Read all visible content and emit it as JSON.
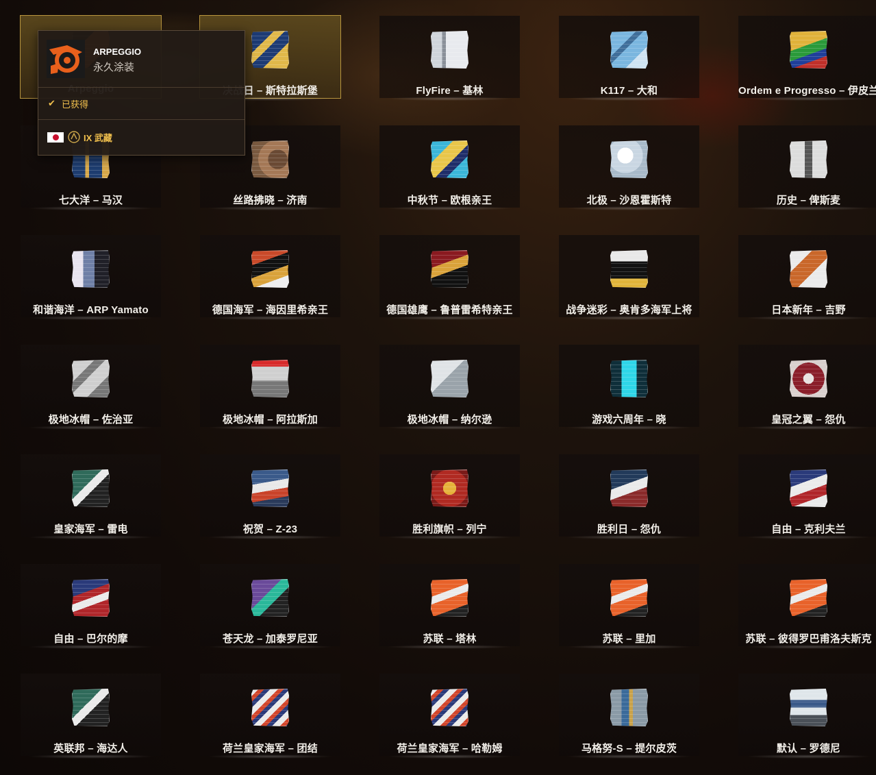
{
  "colors": {
    "accent_gold": "#f2c14e",
    "selected_border": "#b8953e"
  },
  "tooltip": {
    "camo_name": "ARPEGGIO",
    "camo_type": "永久涂装",
    "status": "已获得",
    "ship": "IX 武藏",
    "flag_icon": "japan-flag-icon",
    "tier_icon": "tier-laurel-icon"
  },
  "camouflages": [
    {
      "label": "Arpeggio",
      "bg": "linear-gradient(135deg,#111 0 30%,#e8601c 30% 70%,#111 70%)",
      "selected": true
    },
    {
      "label": "决战日 – 斯特拉斯堡",
      "bg": "linear-gradient(135deg,#1d3b74 0 30%,#e0b84a 30% 45%,#1d3b74 45% 65%,#e0b84a 65%)",
      "selected": true
    },
    {
      "label": "FlyFire – 基林",
      "bg": "linear-gradient(90deg,#cfd4da 0 30%,#8a9099 30% 40%,#e8eaee 40%)",
      "selected": false
    },
    {
      "label": "K117 – 大和",
      "bg": "linear-gradient(135deg,#7ab6df 0 35%,#3f6e9a 35% 45%,#7ab6df 45% 70%,#cfe3f2 70%)",
      "selected": false
    },
    {
      "label": "Ordem e Progresso – 伊皮兰加",
      "bg": "linear-gradient(160deg,#e0b23a 0 40%,#2a9a3a 40% 60%,#1f3f9a 60% 75%,#c0302a 75%)",
      "selected": false
    },
    {
      "label": "七大洋 – 马汉",
      "bg": "linear-gradient(90deg,#1e3d70 0 35%,#d7a84a 35% 45%,#1e3d70 45% 80%,#d7a84a 80%)",
      "selected": false
    },
    {
      "label": "丝路拂晓 – 济南",
      "bg": "radial-gradient(circle at 70% 50%,#6a4a34 0 30%,#a47856 30% 60%,#7a5a40 60%)",
      "selected": false
    },
    {
      "label": "中秋节 – 欧根亲王",
      "bg": "linear-gradient(135deg,#3bb6d9 0 30%,#e8c64a 30% 55%,#1f2e6a 55% 70%,#3bb6d9 70%)",
      "selected": false
    },
    {
      "label": "北极 – 沙恩霍斯特",
      "bg": "radial-gradient(circle at 40% 40%,#ffffff 0 25%,#c9d6e2 25% 55%,#a8bac9 55%)",
      "selected": false
    },
    {
      "label": "历史 – 俾斯麦",
      "bg": "linear-gradient(90deg,#dcdcdc 0 40%,#555 40% 60%,#dcdcdc 60%)",
      "selected": false
    },
    {
      "label": "和谐海洋 – ARP Yamato",
      "bg": "linear-gradient(90deg,#e8e4ef 0 30%,#6e7fa6 30% 60%,#202028 60%)",
      "selected": false
    },
    {
      "label": "德国海军 – 海因里希亲王",
      "bg": "linear-gradient(160deg,#c94a2a 0 30%,#111 30% 55%,#d9a23a 55% 75%,#eee 75%)",
      "selected": false
    },
    {
      "label": "德国雄鹰 – 鲁普雷希特亲王",
      "bg": "linear-gradient(160deg,#8a1a20 0 35%,#d9a23a 35% 55%,#111 55%)",
      "selected": false
    },
    {
      "label": "战争迷彩 – 奥肯多海军上将",
      "bg": "linear-gradient(180deg,#e8e8e8 0 30%,#111 30% 75%,#e0b43a 75%)",
      "selected": false
    },
    {
      "label": "日本新年 – 吉野",
      "bg": "linear-gradient(135deg,#eaeaea 0 30%,#c9672a 30% 60%,#eaeaea 60%)",
      "selected": false
    },
    {
      "label": "极地冰帽 – 佐治亚",
      "bg": "linear-gradient(135deg,#cfcfcf 0 30%,#777 30% 45%,#cfcfcf 45% 70%,#777 70%)",
      "selected": false
    },
    {
      "label": "极地冰帽 – 阿拉斯加",
      "bg": "linear-gradient(180deg,#d82b2b 0 18%,#cfcfcf 18% 55%,#777 55%)",
      "selected": false
    },
    {
      "label": "极地冰帽 – 纳尔逊",
      "bg": "linear-gradient(135deg,#dfe3e6 0 45%,#9aa3aa 45%)",
      "selected": false
    },
    {
      "label": "游戏六周年 – 晓",
      "bg": "linear-gradient(90deg,#0f2f3a 0 30%,#2fd6e8 30% 70%,#0f2f3a 70%)",
      "selected": false
    },
    {
      "label": "皇冠之翼 – 怨仇",
      "bg": "radial-gradient(circle at 50% 50%,#e8e2e0 0 20%,#8a1e2a 20% 60%,#d9d0ce 60%)",
      "selected": false
    },
    {
      "label": "皇家海军 – 雷电",
      "bg": "linear-gradient(135deg,#2f6a5a 0 40%,#eaeaea 40% 55%,#222 55%)",
      "selected": false
    },
    {
      "label": "祝贺 – Z-23",
      "bg": "linear-gradient(170deg,#3a5a8a 0 35%,#e8e8e8 35% 55%,#c9432a 55% 75%,#2a3a5a 75%)",
      "selected": false
    },
    {
      "label": "胜利旗帜 – 列宁",
      "bg": "radial-gradient(circle at 50% 50%,#e6b23a 0 25%,#b02a22 25% 70%,#7a1a18 70%)",
      "selected": false
    },
    {
      "label": "胜利日 – 怨仇",
      "bg": "linear-gradient(160deg,#223a5a 0 40%,#eaeaea 40% 60%,#8a2a2a 60%)",
      "selected": false
    },
    {
      "label": "自由 – 克利夫兰",
      "bg": "linear-gradient(160deg,#2a3a7a 0 35%,#eaeaea 35% 55%,#b0262a 55% 75%,#eaeaea 75%)",
      "selected": false
    },
    {
      "label": "自由 – 巴尔的摩",
      "bg": "linear-gradient(160deg,#2a3a7a 0 35%,#b0262a 35% 50%,#eaeaea 50% 65%,#b0262a 65%)",
      "selected": false
    },
    {
      "label": "苍天龙 – 加泰罗尼亚",
      "bg": "linear-gradient(135deg,#6a4a9a 0 40%,#2ab89a 40% 60%,#222 60%)",
      "selected": false
    },
    {
      "label": "苏联 – 塔林",
      "bg": "linear-gradient(160deg,#e8622a 0 35%,#eaeaea 35% 50%,#e8622a 50% 75%,#222 75%)",
      "selected": false
    },
    {
      "label": "苏联 – 里加",
      "bg": "linear-gradient(160deg,#e8622a 0 35%,#eaeaea 35% 50%,#e8622a 50% 75%,#222 75%)",
      "selected": false
    },
    {
      "label": "苏联 – 彼得罗巴甫洛夫斯克",
      "bg": "linear-gradient(160deg,#e8622a 0 35%,#eaeaea 35% 50%,#e8622a 50% 75%,#222 75%)",
      "selected": false
    },
    {
      "label": "英联邦 – 海达人",
      "bg": "linear-gradient(135deg,#2f6a5a 0 40%,#eaeaea 40% 55%,#222 55%)",
      "selected": false
    },
    {
      "label": "荷兰皇家海军 – 团结",
      "bg": "repeating-linear-gradient(135deg,#eaeaea 0 8px,#d2452a 8px 14px,#2a3a7a 14px 20px)",
      "selected": false
    },
    {
      "label": "荷兰皇家海军 – 哈勒姆",
      "bg": "repeating-linear-gradient(135deg,#eaeaea 0 8px,#d2452a 8px 14px,#2a3a7a 14px 20px)",
      "selected": false
    },
    {
      "label": "马格努-S – 提尔皮茨",
      "bg": "linear-gradient(90deg,#8a9aa6 0 30%,#3a6a9a 30% 50%,#c9a24a 50% 60%,#8a9aa6 60%)",
      "selected": false
    },
    {
      "label": "默认 – 罗德尼",
      "bg": "linear-gradient(180deg,#dfe6ea 0 30%,#3a5a8a 30% 50%,#dfe6ea 50% 70%,#4a5058 70%)",
      "selected": false
    }
  ]
}
